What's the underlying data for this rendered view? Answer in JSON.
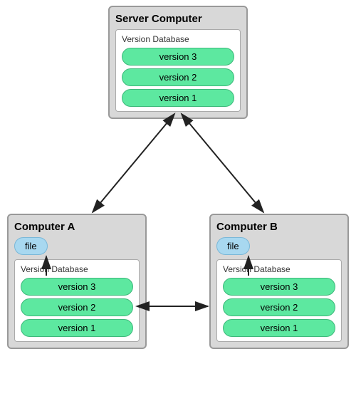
{
  "server": {
    "title": "Server Computer",
    "db_label": "Version Database",
    "versions": [
      "version 3",
      "version 2",
      "version 1"
    ]
  },
  "computerA": {
    "title": "Computer A",
    "file_label": "file",
    "db_label": "Version Database",
    "versions": [
      "version 3",
      "version 2",
      "version 1"
    ]
  },
  "computerB": {
    "title": "Computer B",
    "file_label": "file",
    "db_label": "Version Database",
    "versions": [
      "version 3",
      "version 2",
      "version 1"
    ]
  }
}
